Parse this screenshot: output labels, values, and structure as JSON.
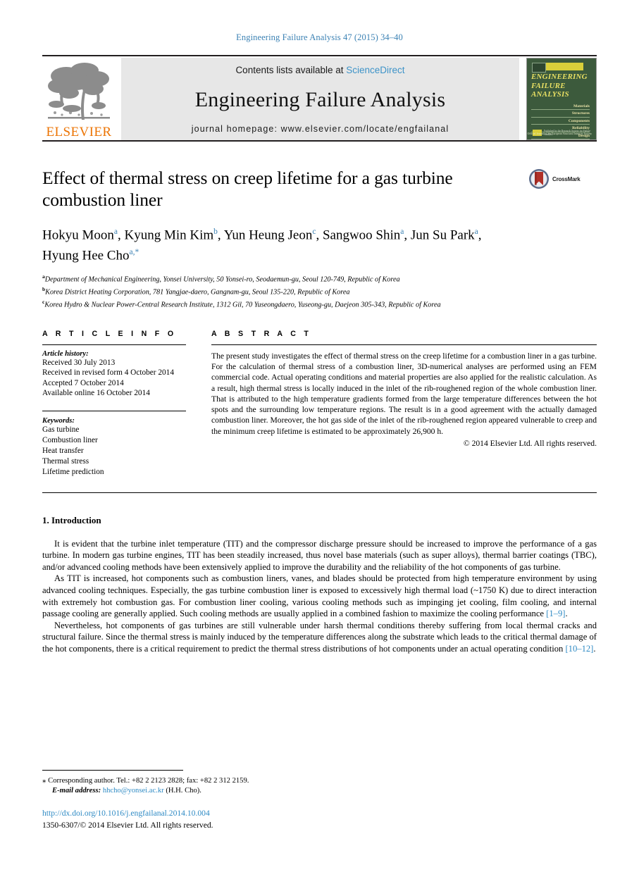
{
  "running_head": "Engineering Failure Analysis 47 (2015) 34–40",
  "masthead": {
    "elsevier_wordmark": "ELSEVIER",
    "contents_prefix": "Contents lists available at ",
    "sciencedirect": "ScienceDirect",
    "journal_title": "Engineering Failure Analysis",
    "homepage": "journal homepage: www.elsevier.com/locate/engfailanal",
    "cover": {
      "title_lines": [
        "ENGINEERING",
        "FAILURE",
        "ANALYSIS"
      ],
      "subjects": [
        "Materials",
        "Structures",
        "Components",
        "Reliability",
        "Design"
      ],
      "publisher_mark": "Published by the Research Society for Failure Analysis",
      "society_line": "Official Journal of\nthe European Structural Integrity Society"
    }
  },
  "article": {
    "title": "Effect of thermal stress on creep lifetime for a gas turbine combustion liner",
    "crossmark_label": "CrossMark",
    "authors_line_1": "Hokyu Moon a, Kyung Min Kim b, Yun Heung Jeon c, Sangwoo Shin a, Jun Su Park a,",
    "authors_line_2": "Hyung Hee Cho a,*",
    "authors": [
      {
        "name": "Hokyu Moon",
        "sup": "a",
        "sep": ", "
      },
      {
        "name": "Kyung Min Kim",
        "sup": "b",
        "sep": ", "
      },
      {
        "name": "Yun Heung Jeon",
        "sup": "c",
        "sep": ", "
      },
      {
        "name": "Sangwoo Shin",
        "sup": "a",
        "sep": ", "
      },
      {
        "name": "Jun Su Park",
        "sup": "a",
        "sep": ", "
      },
      {
        "name": "Hyung Hee Cho",
        "sup": "a,*",
        "sep": ""
      }
    ],
    "affiliations": [
      {
        "marker": "a",
        "text": "Department of Mechanical Engineering, Yonsei University, 50 Yonsei-ro, Seodaemun-gu, Seoul 120-749, Republic of Korea"
      },
      {
        "marker": "b",
        "text": "Korea District Heating Corporation, 781 Yangjae-daero, Gangnam-gu, Seoul 135-220, Republic of Korea"
      },
      {
        "marker": "c",
        "text": "Korea Hydro & Nuclear Power-Central Research Institute, 1312 Gil, 70 Yuseongdaero, Yuseong-gu, Daejeon 305-343, Republic of Korea"
      }
    ]
  },
  "article_info": {
    "heading": "A R T I C L E   I N F O",
    "history_label": "Article history:",
    "history": [
      "Received 30 July 2013",
      "Received in revised form 4 October 2014",
      "Accepted 7 October 2014",
      "Available online 16 October 2014"
    ],
    "keywords_label": "Keywords:",
    "keywords": [
      "Gas turbine",
      "Combustion liner",
      "Heat transfer",
      "Thermal stress",
      "Lifetime prediction"
    ]
  },
  "abstract": {
    "heading": "A B S T R A C T",
    "text": "The present study investigates the effect of thermal stress on the creep lifetime for a combustion liner in a gas turbine. For the calculation of thermal stress of a combustion liner, 3D-numerical analyses are performed using an FEM commercial code. Actual operating conditions and material properties are also applied for the realistic calculation. As a result, high thermal stress is locally induced in the inlet of the rib-roughened region of the whole combustion liner. That is attributed to the high temperature gradients formed from the large temperature differences between the hot spots and the surrounding low temperature regions. The result is in a good agreement with the actually damaged combustion liner. Moreover, the hot gas side of the inlet of the rib-roughened region appeared vulnerable to creep and the minimum creep lifetime is estimated to be approximately 26,900 h.",
    "copyright": "© 2014 Elsevier Ltd. All rights reserved."
  },
  "introduction": {
    "heading": "1. Introduction",
    "paragraph_1": "It is evident that the turbine inlet temperature (TIT) and the compressor discharge pressure should be increased to improve the performance of a gas turbine. In modern gas turbine engines, TIT has been steadily increased, thus novel base materials (such as super alloys), thermal barrier coatings (TBC), and/or advanced cooling methods have been extensively applied to improve the durability and the reliability of the hot components of gas turbine.",
    "paragraph_2_a": "As TIT is increased, hot components such as combustion liners, vanes, and blades should be protected from high temperature environment by using advanced cooling techniques. Especially, the gas turbine combustion liner is exposed to excessively high thermal load (~1750 K) due to direct interaction with extremely hot combustion gas. For combustion liner cooling, various cooling methods such as impinging jet cooling, film cooling, and internal passage cooling are generally applied. Such cooling methods are usually applied in a combined fashion to maximize the cooling performance ",
    "paragraph_2_ref": "[1–9]",
    "paragraph_2_b": ".",
    "paragraph_3_a": "Nevertheless, hot components of gas turbines are still vulnerable under harsh thermal conditions thereby suffering from local thermal cracks and structural failure. Since the thermal stress is mainly induced by the temperature differences along the substrate which leads to the critical thermal damage of the hot components, there is a critical requirement to predict the thermal stress distributions of hot components under an actual operating condition ",
    "paragraph_3_ref": "[10–12]",
    "paragraph_3_b": "."
  },
  "footnotes": {
    "corresponding": "Corresponding author. Tel.: +82 2 2123 2828; fax: +82 2 312 2159.",
    "email_label": "E-mail address:",
    "email": "hhcho@yonsei.ac.kr",
    "email_owner": "(H.H. Cho).",
    "doi": "http://dx.doi.org/10.1016/j.engfailanal.2014.10.004",
    "issn_line": "1350-6307/© 2014 Elsevier Ltd. All rights reserved."
  },
  "colors": {
    "link_blue": "#2e8ac4",
    "running_head_blue": "#3c82b4",
    "elsevier_orange": "#ec7404",
    "cover_green": "#3c5a3c",
    "cover_yellow": "#d9cf3a"
  }
}
